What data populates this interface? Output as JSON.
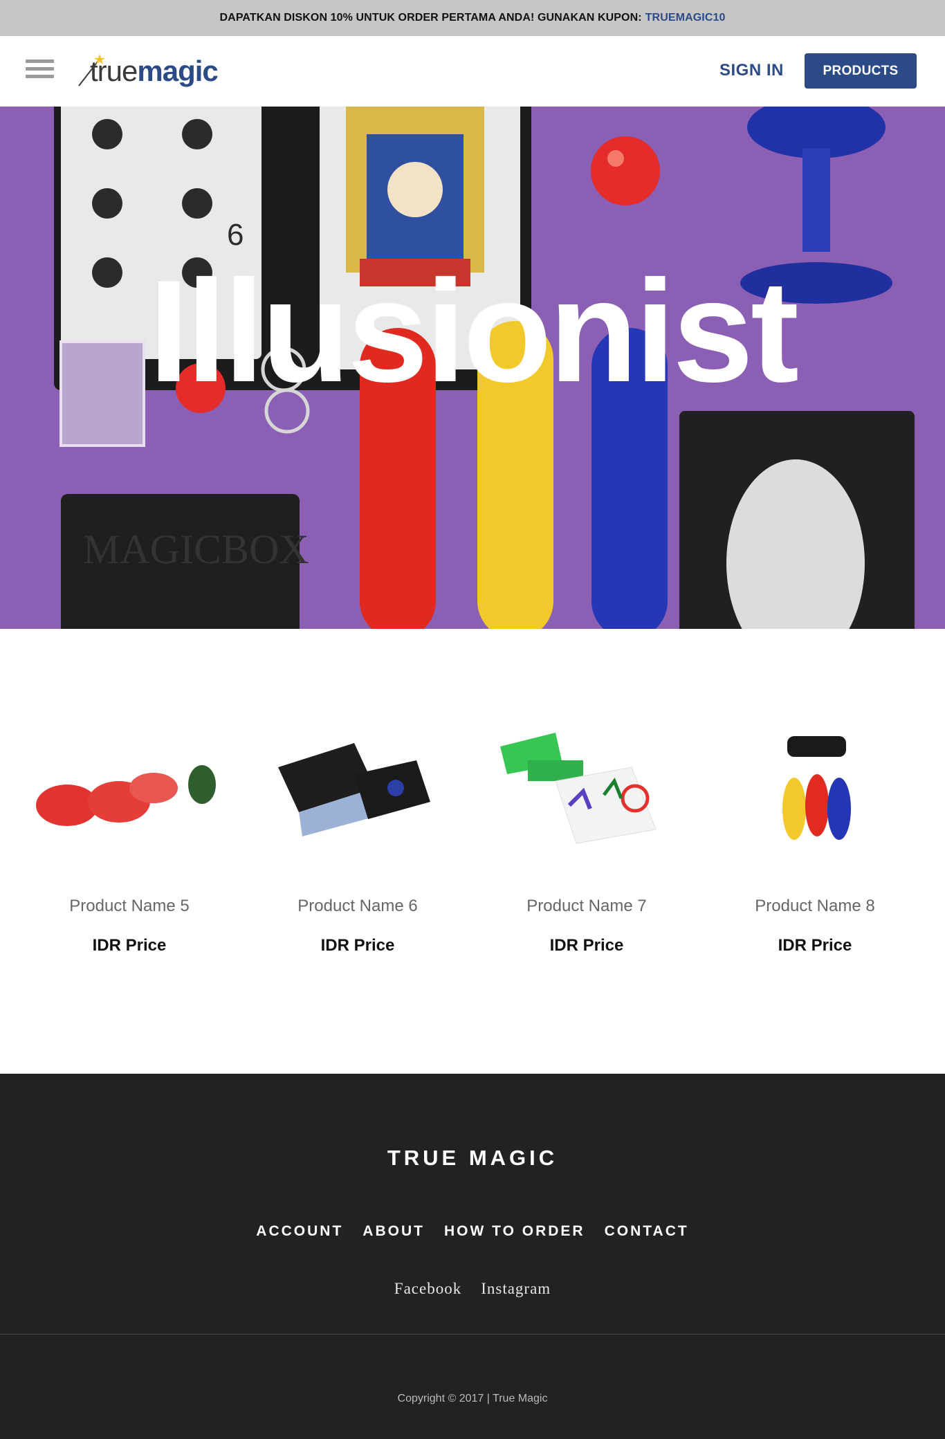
{
  "promo": {
    "text": "DAPATKAN DISKON 10% UNTUK ORDER PERTAMA ANDA! GUNAKAN KUPON:",
    "code": "TRUEMAGIC10"
  },
  "header": {
    "logo_true": "true",
    "logo_magic": "magic",
    "signin_label": "SIGN IN",
    "products_label": "PRODUCTS"
  },
  "hero": {
    "title": "Illusionist"
  },
  "products": [
    {
      "name": "Product Name 5",
      "price": "IDR Price"
    },
    {
      "name": "Product Name 6",
      "price": "IDR Price"
    },
    {
      "name": "Product Name 7",
      "price": "IDR Price"
    },
    {
      "name": "Product Name 8",
      "price": "IDR Price"
    }
  ],
  "footer": {
    "brand": "TRUE MAGIC",
    "nav": [
      "ACCOUNT",
      "ABOUT",
      "HOW TO ORDER",
      "CONTACT"
    ],
    "social": [
      "Facebook",
      "Instagram"
    ],
    "copyright": "Copyright © 2017 | True Magic"
  },
  "colors": {
    "accent": "#2c4a86",
    "promo_bg": "#c6c6c6",
    "hero_bg": "#8b5fb4",
    "footer_bg": "#222222"
  }
}
